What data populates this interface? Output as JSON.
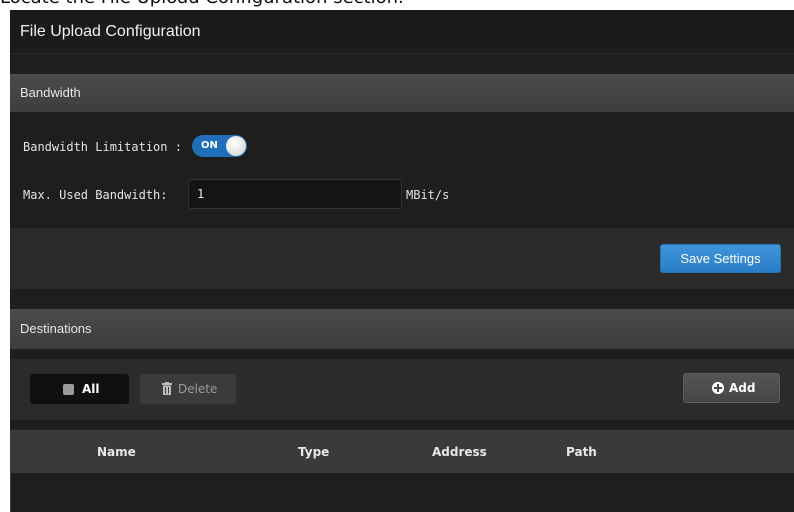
{
  "caption": "Locate the File Upload Configuration section.",
  "panel": {
    "title": "File Upload Configuration"
  },
  "bandwidth": {
    "section_title": "Bandwidth",
    "limitation_label": "Bandwidth Limitation :",
    "toggle_state": "ON",
    "max_label": "Max. Used Bandwidth:",
    "max_value": "1",
    "unit": "MBit/s",
    "save_label": "Save Settings"
  },
  "destinations": {
    "section_title": "Destinations",
    "all_label": "All",
    "delete_label": "Delete",
    "add_label": "Add",
    "columns": [
      "Name",
      "Type",
      "Address",
      "Path"
    ],
    "rows": []
  },
  "colors": {
    "accent": "#2a7ec7",
    "background": "#1e1e1e",
    "section_header": "#444444"
  },
  "icons": {
    "delete": "trash-icon",
    "add": "plus-circle-icon",
    "select_all": "checkbox-icon"
  }
}
